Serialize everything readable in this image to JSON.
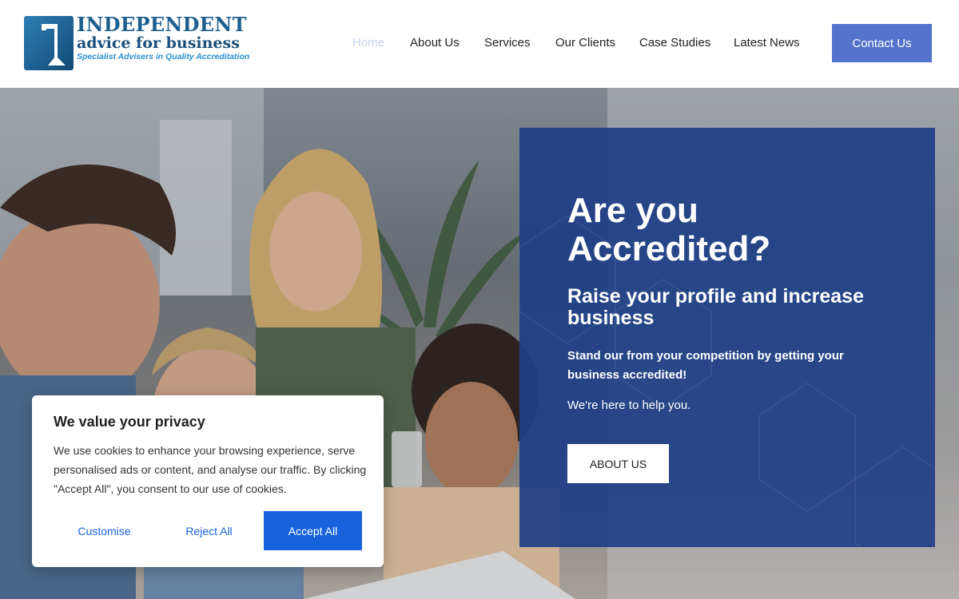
{
  "brand": {
    "line1": "INDEPENDENT",
    "line2": "advice for business",
    "line3": "Specialist Advisers in Quality Accreditation",
    "colors": {
      "primary": "#1d5f8f",
      "tagline": "#2a8fd0"
    }
  },
  "nav": {
    "items": [
      {
        "label": "Home",
        "active": true
      },
      {
        "label": "About Us",
        "active": false
      },
      {
        "label": "Services",
        "active": false
      },
      {
        "label": "Our Clients",
        "active": false
      },
      {
        "label": "Case Studies",
        "active": false
      },
      {
        "label": "Latest News",
        "active": false
      }
    ],
    "cta_label": "Contact Us",
    "cta_color": "#5474cc"
  },
  "hero": {
    "title": "Are you Accredited?",
    "subtitle": "Raise your profile and increase business",
    "lead": "Stand our from your competition by getting your business accredited!",
    "help_text": "We're here to help you.",
    "button_label": "ABOUT US",
    "panel_color": "#1f3f87"
  },
  "cookie_banner": {
    "title": "We value your privacy",
    "text": "We use cookies to enhance your browsing experience, serve personalised ads or content, and analyse our traffic. By clicking \"Accept All\", you consent to our use of cookies.",
    "customise_label": "Customise",
    "reject_label": "Reject All",
    "accept_label": "Accept All",
    "accent_color": "#1863dc"
  }
}
